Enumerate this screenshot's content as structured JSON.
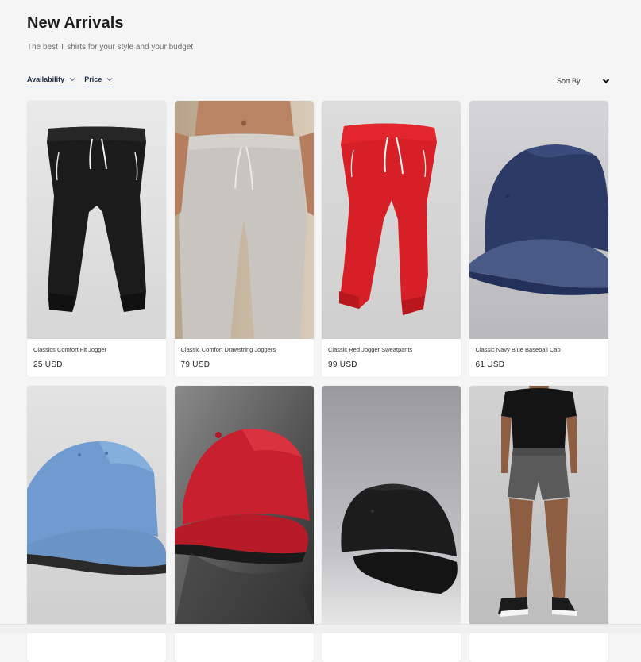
{
  "header": {
    "title": "New Arrivals",
    "subtitle": "The best T shirts for your style and your budget"
  },
  "filters": [
    {
      "label": "Availability",
      "icon": "chevron-down-icon"
    },
    {
      "label": "Price",
      "icon": "chevron-down-icon"
    }
  ],
  "sort": {
    "label": "Sort By",
    "icon": "chevron-down-icon"
  },
  "products": [
    {
      "name": "Classics Comfort Fit Jogger",
      "price": "25 USD",
      "image": "black-jogger"
    },
    {
      "name": "Classic Comfort Drawstring Joggers",
      "price": "79 USD",
      "image": "grey-joggers-on-model"
    },
    {
      "name": "Classic Red Jogger Sweatpants",
      "price": "99 USD",
      "image": "red-jogger"
    },
    {
      "name": "Classic Navy Blue Baseball Cap",
      "price": "61 USD",
      "image": "navy-cap"
    },
    {
      "name": "",
      "price": "",
      "image": "light-blue-cap"
    },
    {
      "name": "",
      "price": "",
      "image": "red-cap"
    },
    {
      "name": "",
      "price": "",
      "image": "black-cap"
    },
    {
      "name": "",
      "price": "",
      "image": "model-black-tee-grey-shorts"
    }
  ],
  "colors": {
    "background": "#f5f5f5",
    "filter_text": "#1d2b45",
    "card_bg": "#ffffff"
  }
}
